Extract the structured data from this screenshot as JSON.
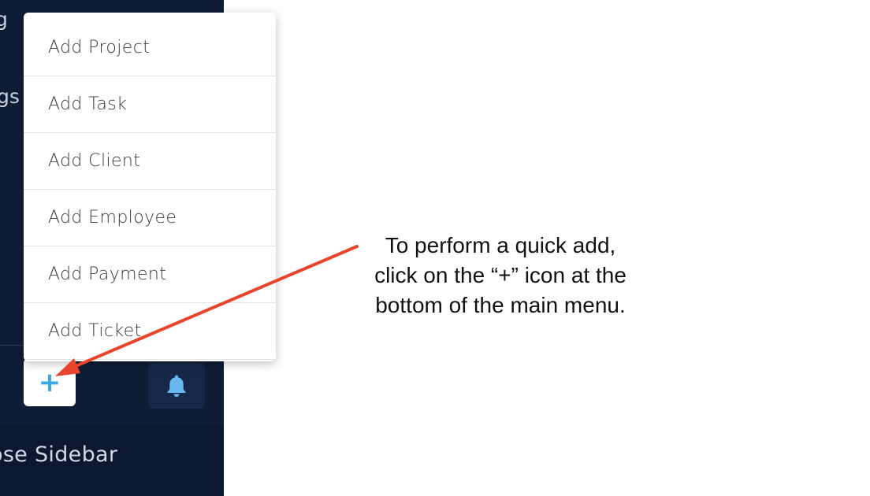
{
  "sidebar": {
    "fragment_top": "g",
    "fragment_settings": "gs",
    "quick_add_symbol": "+",
    "close_label": "ose Sidebar"
  },
  "quick_add_menu": {
    "items": [
      {
        "label": "Add Project"
      },
      {
        "label": "Add Task"
      },
      {
        "label": "Add Client"
      },
      {
        "label": "Add Employee"
      },
      {
        "label": "Add Payment"
      },
      {
        "label": "Add Ticket"
      }
    ]
  },
  "annotation": {
    "line1": "To perform a quick add,",
    "line2": "click on the “+” icon at the",
    "line3": "bottom of the main menu."
  },
  "colors": {
    "sidebar_bg": "#0f1c36",
    "accent": "#36a7e8",
    "arrow": "#e8452c"
  },
  "icons": {
    "quick_add": "plus-icon",
    "notifications": "bell-icon",
    "pointer": "arrow-icon"
  }
}
